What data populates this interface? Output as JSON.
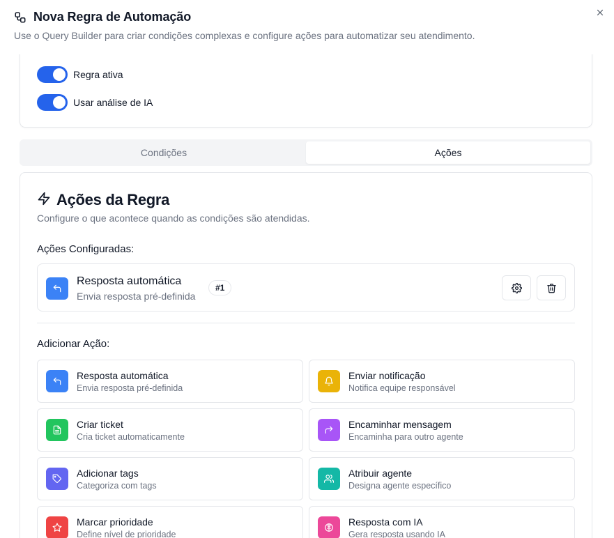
{
  "dialog": {
    "title": "Nova Regra de Automação",
    "subtitle": "Use o Query Builder para criar condições complexas e configure ações para automatizar seu atendimento."
  },
  "toggles": [
    {
      "label": "Regra ativa",
      "on": true
    },
    {
      "label": "Usar análise de IA",
      "on": true
    }
  ],
  "tabs": [
    {
      "label": "Condições",
      "active": false
    },
    {
      "label": "Ações",
      "active": true
    }
  ],
  "actions_card": {
    "title": "Ações da Regra",
    "description": "Configure o que acontece quando as condições são atendidas.",
    "configured_label": "Ações Configuradas:",
    "add_label": "Adicionar Ação:"
  },
  "configured": [
    {
      "title": "Resposta automática",
      "desc": "Envia resposta pré-definida",
      "badge": "#1",
      "icon": "reply-icon",
      "color": "#3b82f6"
    }
  ],
  "options": [
    {
      "title": "Resposta automática",
      "desc": "Envia resposta pré-definida",
      "icon": "reply-icon",
      "color": "#3b82f6"
    },
    {
      "title": "Enviar notificação",
      "desc": "Notifica equipe responsável",
      "icon": "bell-icon",
      "color": "#eab308"
    },
    {
      "title": "Criar ticket",
      "desc": "Cria ticket automaticamente",
      "icon": "file-icon",
      "color": "#22c55e"
    },
    {
      "title": "Encaminhar mensagem",
      "desc": "Encaminha para outro agente",
      "icon": "forward-icon",
      "color": "#a855f7"
    },
    {
      "title": "Adicionar tags",
      "desc": "Categoriza com tags",
      "icon": "tag-icon",
      "color": "#6366f1"
    },
    {
      "title": "Atribuir agente",
      "desc": "Designa agente específico",
      "icon": "users-icon",
      "color": "#14b8a6"
    },
    {
      "title": "Marcar prioridade",
      "desc": "Define nível de prioridade",
      "icon": "star-icon",
      "color": "#ef4444"
    },
    {
      "title": "Resposta com IA",
      "desc": "Gera resposta usando IA",
      "icon": "brain-icon",
      "color": "#ec4899"
    }
  ]
}
